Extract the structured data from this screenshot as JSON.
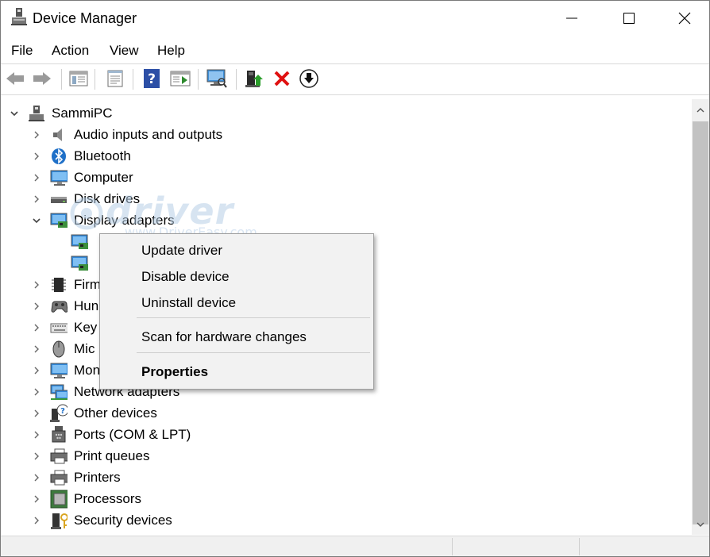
{
  "window": {
    "title": "Device Manager"
  },
  "menu": [
    "File",
    "Action",
    "View",
    "Help"
  ],
  "toolbar": {
    "icons": [
      "back-arrow-icon",
      "forward-arrow-icon",
      "show-hide-console-tree-icon",
      "properties-icon",
      "help-icon",
      "action-pane-icon",
      "scan-hardware-icon",
      "update-driver-icon",
      "uninstall-device-icon",
      "disable-device-icon"
    ]
  },
  "tree": {
    "root": "SammiPC",
    "items": [
      {
        "label": "Audio inputs and outputs",
        "icon": "speaker-icon"
      },
      {
        "label": "Bluetooth",
        "icon": "bluetooth-icon"
      },
      {
        "label": "Computer",
        "icon": "monitor-icon"
      },
      {
        "label": "Disk drives",
        "icon": "disk-drive-icon"
      },
      {
        "label": "Display adapters",
        "icon": "display-adapter-icon"
      },
      {
        "label": "",
        "icon": "display-adapter-icon"
      },
      {
        "label": "",
        "icon": "display-adapter-icon"
      },
      {
        "label": "Firm",
        "icon": "firmware-chip-icon"
      },
      {
        "label": "Hun",
        "icon": "gamepad-icon"
      },
      {
        "label": "Key",
        "icon": "keyboard-icon"
      },
      {
        "label": "Mic",
        "icon": "mouse-icon"
      },
      {
        "label": "Mon",
        "icon": "monitor-icon"
      },
      {
        "label": "Network adapters",
        "icon": "network-icon"
      },
      {
        "label": "Other devices",
        "icon": "unknown-device-icon"
      },
      {
        "label": "Ports (COM & LPT)",
        "icon": "port-icon"
      },
      {
        "label": "Print queues",
        "icon": "printer-icon"
      },
      {
        "label": "Printers",
        "icon": "printer-icon"
      },
      {
        "label": "Processors",
        "icon": "processor-icon"
      },
      {
        "label": "Security devices",
        "icon": "security-key-icon"
      }
    ]
  },
  "watermark": {
    "text": "driver easy",
    "url": "www.DriverEasy.com"
  },
  "context_menu": {
    "items": [
      "Update driver",
      "Disable device",
      "Uninstall device",
      "Scan for hardware changes",
      "Properties"
    ]
  }
}
